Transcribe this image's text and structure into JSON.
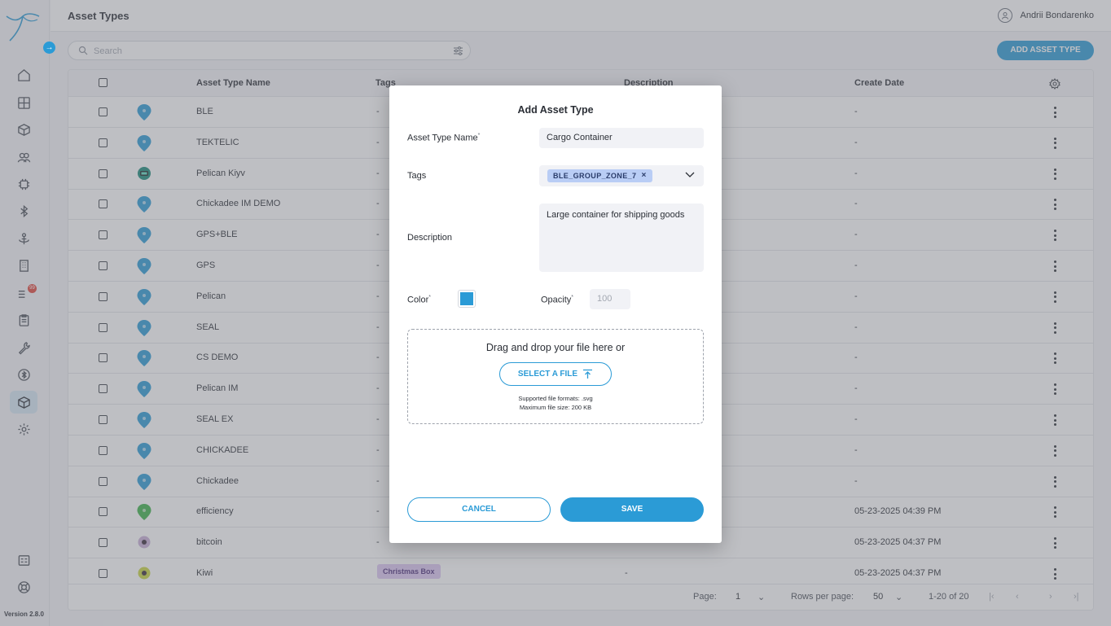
{
  "app": {
    "page_title": "Asset Types",
    "user_name": "Andrii Bondarenko",
    "version": "Version 2.8.0",
    "nav_badge": "99"
  },
  "sidebar": {
    "items": [
      {
        "icon": "home-icon"
      },
      {
        "icon": "dashboard-icon"
      },
      {
        "icon": "box-icon"
      },
      {
        "icon": "users-icon"
      },
      {
        "icon": "chip-icon"
      },
      {
        "icon": "bluetooth-icon"
      },
      {
        "icon": "anchor-icon"
      },
      {
        "icon": "building-icon"
      },
      {
        "icon": "list-alert-icon"
      },
      {
        "icon": "clipboard-icon"
      },
      {
        "icon": "wrench-icon"
      },
      {
        "icon": "bluetooth-circle-icon"
      },
      {
        "icon": "asset-types-icon",
        "active": true
      },
      {
        "icon": "settings-icon"
      }
    ],
    "bottom": [
      {
        "icon": "calendar-icon"
      },
      {
        "icon": "help-icon"
      }
    ]
  },
  "toolbar": {
    "search_placeholder": "Search",
    "add_button": "ADD ASSET TYPE"
  },
  "table": {
    "headers": {
      "name": "Asset Type Name",
      "tags": "Tags",
      "description": "Description",
      "create_date": "Create Date"
    },
    "rows": [
      {
        "name": "BLE",
        "tags": "-",
        "description": "",
        "date": "-",
        "pin_color": "#2b9bd6",
        "pin": "pin"
      },
      {
        "name": "TEKTELIC",
        "tags": "-",
        "description": "",
        "date": "-",
        "pin_color": "#2b9bd6",
        "pin": "pin"
      },
      {
        "name": "Pelican Kiyv",
        "tags": "-",
        "description": "",
        "date": "-",
        "pin_color": "#1a8a7a",
        "pin": "device"
      },
      {
        "name": "Chickadee IM DEMO",
        "tags": "-",
        "description": "",
        "date": "-",
        "pin_color": "#2b9bd6",
        "pin": "pin"
      },
      {
        "name": "GPS+BLE",
        "tags": "-",
        "description": "",
        "date": "-",
        "pin_color": "#2b9bd6",
        "pin": "pin"
      },
      {
        "name": "GPS",
        "tags": "-",
        "description": "",
        "date": "-",
        "pin_color": "#2b9bd6",
        "pin": "pin"
      },
      {
        "name": "Pelican",
        "tags": "-",
        "description": "",
        "date": "-",
        "pin_color": "#2b9bd6",
        "pin": "pin"
      },
      {
        "name": "SEAL",
        "tags": "-",
        "description": "",
        "date": "-",
        "pin_color": "#2b9bd6",
        "pin": "pin"
      },
      {
        "name": "CS DEMO",
        "tags": "-",
        "description": "",
        "date": "-",
        "pin_color": "#2b9bd6",
        "pin": "pin"
      },
      {
        "name": "Pelican IM",
        "tags": "-",
        "description": "",
        "date": "-",
        "pin_color": "#2b9bd6",
        "pin": "pin"
      },
      {
        "name": "SEAL EX",
        "tags": "-",
        "description": "",
        "date": "-",
        "pin_color": "#2b9bd6",
        "pin": "pin"
      },
      {
        "name": "CHICKADEE",
        "tags": "-",
        "description": "",
        "date": "-",
        "pin_color": "#2b9bd6",
        "pin": "pin"
      },
      {
        "name": "Chickadee",
        "tags": "-",
        "description": "",
        "date": "-",
        "pin_color": "#2b9bd6",
        "pin": "pin"
      },
      {
        "name": "efficiency",
        "tags": "-",
        "description": "",
        "date": "05-23-2025 04:39 PM",
        "pin_color": "#3db34a",
        "pin": "pin"
      },
      {
        "name": "bitcoin",
        "tags": "-",
        "description": "",
        "date": "05-23-2025 04:37 PM",
        "pin_color": "#c9b0d8",
        "pin": "circle"
      },
      {
        "name": "Kiwi",
        "tags": "Christmas Box",
        "description": "-",
        "date": "05-23-2025 04:37 PM",
        "pin_color": "#c8d640",
        "pin": "circle"
      }
    ]
  },
  "footer": {
    "page_label": "Page:",
    "page_value": "1",
    "rows_label": "Rows per page:",
    "rows_value": "50",
    "range": "1-20 of 20"
  },
  "modal": {
    "title": "Add Asset Type",
    "name_label": "Asset Type Name",
    "name_value": "Cargo Container",
    "tags_label": "Tags",
    "tag_chip": "BLE_GROUP_ZONE_7",
    "description_label": "Description",
    "description_value": "Large container for shipping goods",
    "color_label": "Color",
    "color_value": "#2b9bd6",
    "opacity_label": "Opacity",
    "opacity_placeholder": "100",
    "dropzone_title": "Drag and drop your file here or",
    "select_file": "SELECT A FILE",
    "formats_note": "Supported file formats: .svg",
    "size_note": "Maximum file size: 200 KB",
    "cancel": "CANCEL",
    "save": "SAVE"
  },
  "colors": {
    "accent": "#2b9bd6"
  }
}
